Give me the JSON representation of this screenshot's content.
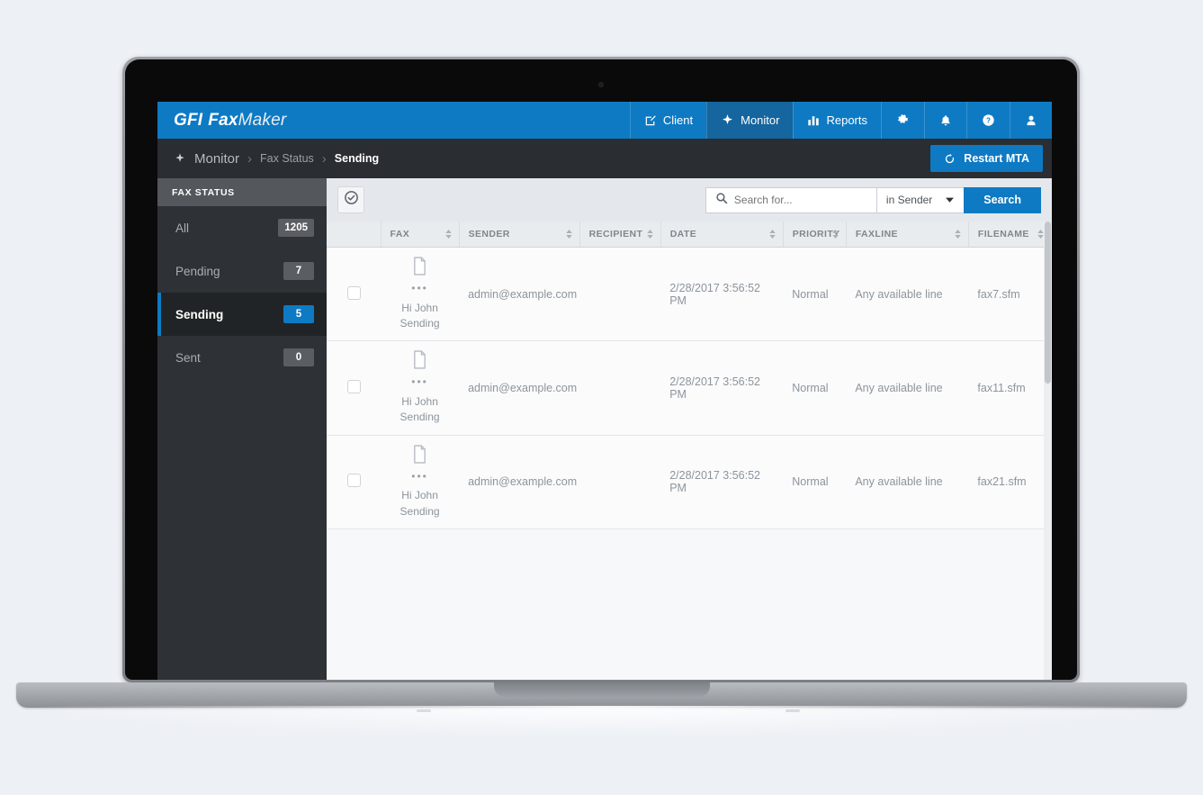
{
  "header": {
    "brand": {
      "gfi": "GFI",
      "fax": "Fax",
      "maker": "Maker"
    },
    "nav": [
      {
        "label": "Client",
        "icon": "compose-icon",
        "active": false
      },
      {
        "label": "Monitor",
        "icon": "sparkle-icon",
        "active": true
      },
      {
        "label": "Reports",
        "icon": "bar-chart-icon",
        "active": false
      },
      {
        "label": "",
        "icon": "gear-icon",
        "active": false
      },
      {
        "label": "",
        "icon": "bell-icon",
        "active": false
      },
      {
        "label": "",
        "icon": "help-icon",
        "active": false
      },
      {
        "label": "",
        "icon": "user-icon",
        "active": false
      }
    ]
  },
  "breadcrumb": {
    "root": "Monitor",
    "middle": "Fax Status",
    "current": "Sending",
    "separator": "›",
    "restart_label": "Restart MTA"
  },
  "sidebar": {
    "title": "FAX STATUS",
    "items": [
      {
        "label": "All",
        "count": "1205",
        "active": false
      },
      {
        "label": "Pending",
        "count": "7",
        "active": false
      },
      {
        "label": "Sending",
        "count": "5",
        "active": true
      },
      {
        "label": "Sent",
        "count": "0",
        "active": false
      }
    ]
  },
  "toolbar": {
    "select_all_icon": "check-circle-icon",
    "search_placeholder": "Search for...",
    "search_value": "",
    "scope_label": "in Sender",
    "search_button": "Search"
  },
  "table": {
    "columns": [
      "FAX",
      "SENDER",
      "RECIPIENT",
      "DATE",
      "PRIORITY",
      "FAXLINE",
      "FILENAME"
    ],
    "rows": [
      {
        "fax_title": "Hi John",
        "fax_status": "Sending",
        "sender": "admin@example.com",
        "recipient": "",
        "date": "2/28/2017 3:56:52 PM",
        "priority": "Normal",
        "faxline": "Any available line",
        "filename": "fax7.sfm"
      },
      {
        "fax_title": "Hi John",
        "fax_status": "Sending",
        "sender": "admin@example.com",
        "recipient": "",
        "date": "2/28/2017 3:56:52 PM",
        "priority": "Normal",
        "faxline": "Any available line",
        "filename": "fax11.sfm"
      },
      {
        "fax_title": "Hi John",
        "fax_status": "Sending",
        "sender": "admin@example.com",
        "recipient": "",
        "date": "2/28/2017 3:56:52 PM",
        "priority": "Normal",
        "faxline": "Any available line",
        "filename": "fax21.sfm"
      }
    ],
    "fax_dots": "•••"
  },
  "colors": {
    "brand_blue": "#0e7ac4",
    "active_nav_blue": "#15659e",
    "sidebar_dark": "#2e3135",
    "sidebar_active": "#212426",
    "crumb_bar": "#2a2d31",
    "page_bg": "#edf0f5"
  }
}
